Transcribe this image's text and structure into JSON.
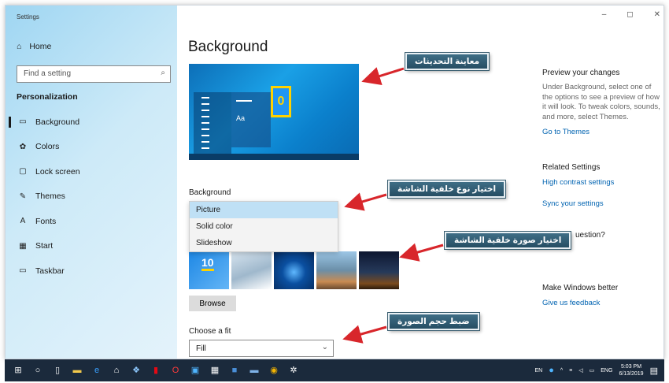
{
  "window": {
    "title": "Settings",
    "controls": [
      "–",
      "◻",
      "✕"
    ]
  },
  "sidebar": {
    "home_label": "Home",
    "search_placeholder": "Find a setting",
    "section": "Personalization",
    "items": [
      {
        "label": "Background",
        "icon": "picture-icon",
        "glyph": "▭"
      },
      {
        "label": "Colors",
        "icon": "palette-icon",
        "glyph": "✿"
      },
      {
        "label": "Lock screen",
        "icon": "lock-screen-icon",
        "glyph": "▢"
      },
      {
        "label": "Themes",
        "icon": "themes-icon",
        "glyph": "✎"
      },
      {
        "label": "Fonts",
        "icon": "fonts-icon",
        "glyph": "A"
      },
      {
        "label": "Start",
        "icon": "start-icon",
        "glyph": "▦"
      },
      {
        "label": "Taskbar",
        "icon": "taskbar-icon",
        "glyph": "▭"
      }
    ]
  },
  "main": {
    "title": "Background",
    "preview_sample_text": "Aa",
    "background_label": "Background",
    "background_options": [
      "Picture",
      "Solid color",
      "Slideshow"
    ],
    "background_selected": "Picture",
    "browse_label": "Browse",
    "fit_label": "Choose a fit",
    "fit_value": "Fill"
  },
  "right": {
    "preview_heading": "Preview your changes",
    "preview_text": "Under Background, select one of the options to see a preview of how it will look. To tweak colors, sounds, and more, select Themes.",
    "go_to_themes": "Go to Themes",
    "related_heading": "Related Settings",
    "high_contrast": "High contrast settings",
    "sync": "Sync your settings",
    "question_partial": "uestion?",
    "better_heading": "Make Windows better",
    "feedback": "Give us feedback"
  },
  "annotations": {
    "preview": "معاينة التحديثات",
    "bg_type": "اختيار نوع خلفية الشاشة",
    "bg_image": "اختيار صورة خلفية الشاشة",
    "fit": "ضبط حجم الصورة"
  },
  "taskbar": {
    "language": "ENG",
    "lang_short": "EN",
    "time": "5:03 PM",
    "date": "6/13/2019"
  },
  "colors": {
    "accent": "#0063b1",
    "taskbar": "#1b2a3c",
    "callout": "#2f5b70"
  }
}
